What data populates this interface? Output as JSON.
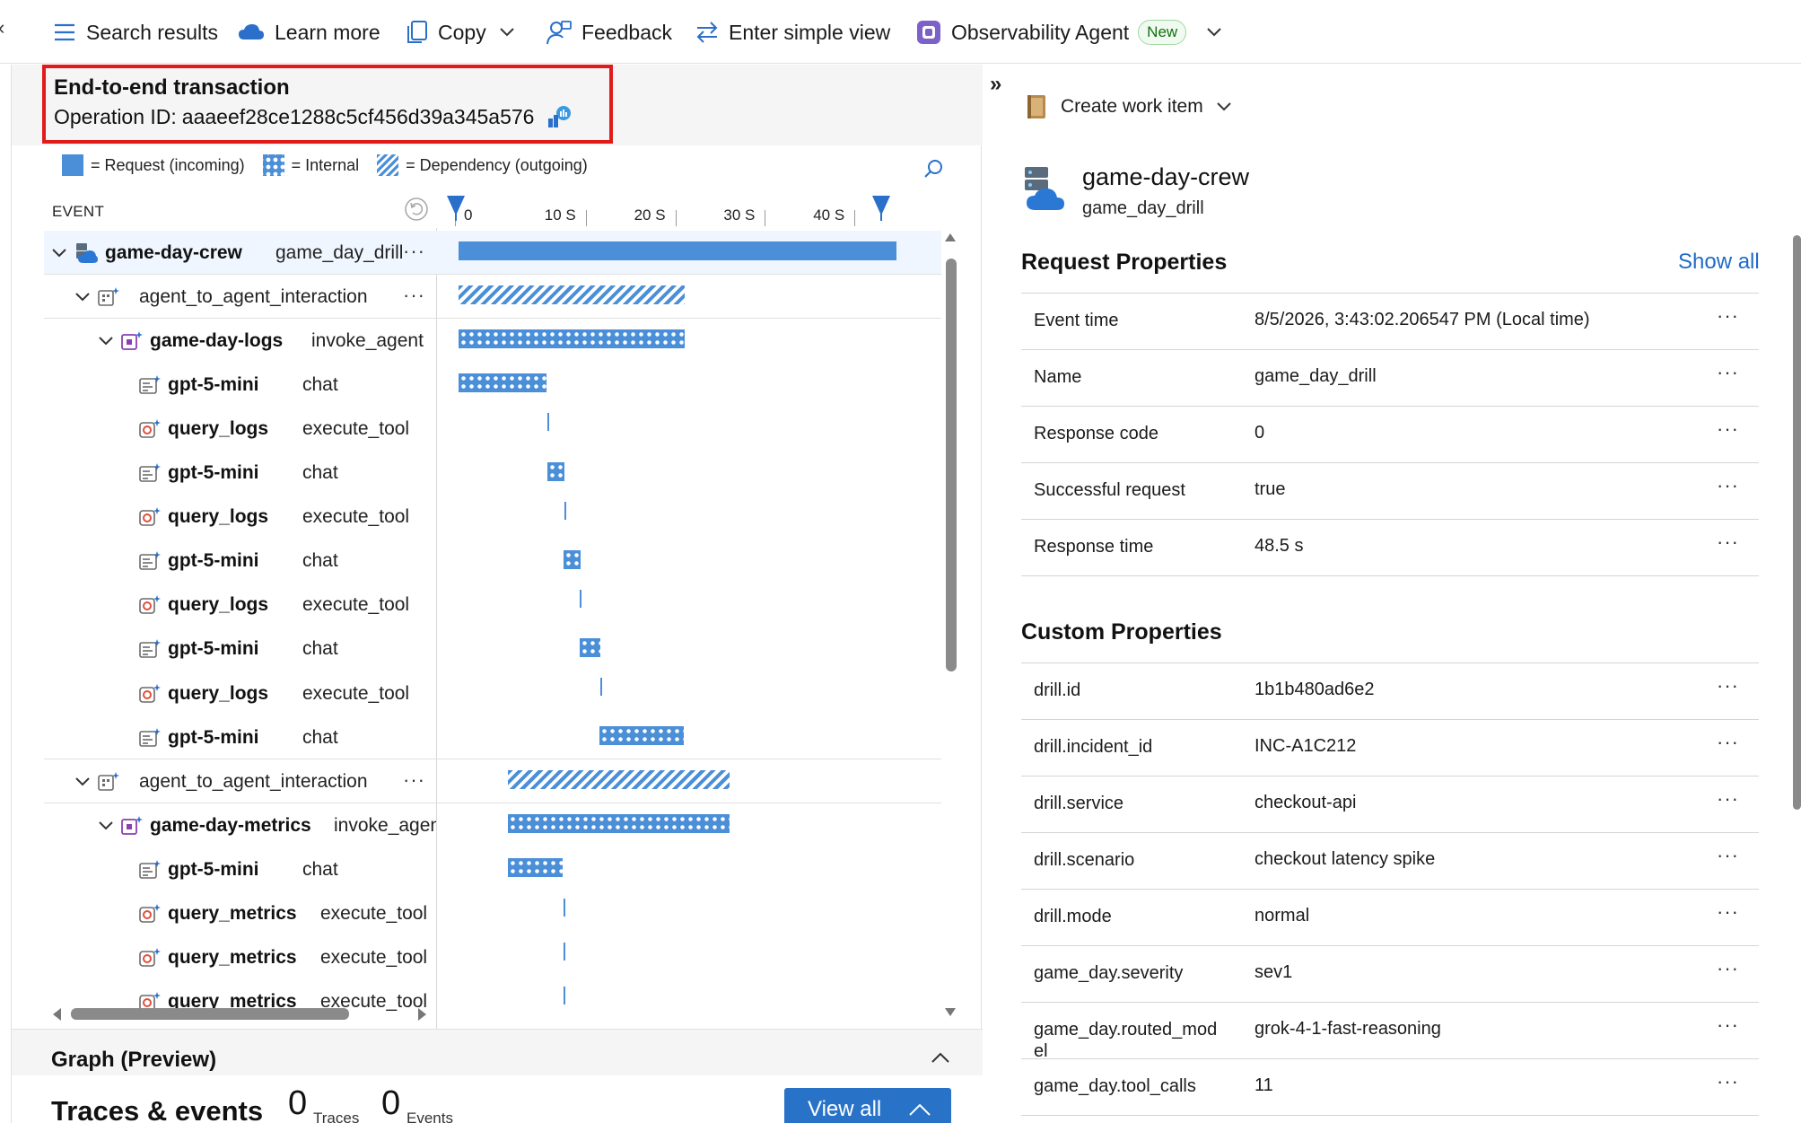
{
  "toolbar": {
    "search_results": "Search results",
    "learn_more": "Learn more",
    "copy": "Copy",
    "feedback": "Feedback",
    "simple_view": "Enter simple view",
    "agent": "Observability Agent",
    "agent_badge": "New"
  },
  "transaction": {
    "title": "End-to-end transaction",
    "operation_label": "Operation ID:",
    "operation_id": "aaaeef28ce1288c5cf456d39a345a576"
  },
  "legend": {
    "request": "= Request (incoming)",
    "internal": "= Internal",
    "dependency": "= Dependency (outgoing)"
  },
  "tree": {
    "column_header": "EVENT",
    "ticks": [
      "0",
      "10 S",
      "20 S",
      "30 S",
      "40 S"
    ],
    "duration_total_s": 48.5,
    "rows": [
      {
        "name": "game-day-crew",
        "type": "game_day_drill",
        "kind": "request",
        "start_s": 0,
        "dur_s": 48.5
      },
      {
        "name": "agent_to_agent_interaction",
        "type": "",
        "kind": "dependency",
        "start_s": 0,
        "dur_s": 25
      },
      {
        "name": "game-day-logs",
        "type": "invoke_agent",
        "kind": "internal",
        "start_s": 0,
        "dur_s": 25
      },
      {
        "name": "gpt-5-mini",
        "type": "chat",
        "kind": "internal",
        "start_s": 0,
        "dur_s": 9.7
      },
      {
        "name": "query_logs",
        "type": "execute_tool",
        "kind": "tool",
        "start_s": 9.8,
        "dur_s": 0
      },
      {
        "name": "gpt-5-mini",
        "type": "chat",
        "kind": "internal",
        "start_s": 9.8,
        "dur_s": 1.9
      },
      {
        "name": "query_logs",
        "type": "execute_tool",
        "kind": "tool",
        "start_s": 11.7,
        "dur_s": 0
      },
      {
        "name": "gpt-5-mini",
        "type": "chat",
        "kind": "internal",
        "start_s": 11.6,
        "dur_s": 1.9
      },
      {
        "name": "query_logs",
        "type": "execute_tool",
        "kind": "tool",
        "start_s": 13.4,
        "dur_s": 0
      },
      {
        "name": "gpt-5-mini",
        "type": "chat",
        "kind": "internal",
        "start_s": 13.4,
        "dur_s": 2.3
      },
      {
        "name": "query_logs",
        "type": "execute_tool",
        "kind": "tool",
        "start_s": 15.7,
        "dur_s": 0
      },
      {
        "name": "gpt-5-mini",
        "type": "chat",
        "kind": "internal",
        "start_s": 15.6,
        "dur_s": 9.4
      },
      {
        "name": "agent_to_agent_interaction",
        "type": "",
        "kind": "dependency",
        "start_s": 5.5,
        "dur_s": 24.5
      },
      {
        "name": "game-day-metrics",
        "type": "invoke_agent",
        "kind": "internal",
        "start_s": 5.5,
        "dur_s": 24.5
      },
      {
        "name": "gpt-5-mini",
        "type": "chat",
        "kind": "internal",
        "start_s": 5.5,
        "dur_s": 6
      },
      {
        "name": "query_metrics",
        "type": "execute_tool",
        "kind": "tool",
        "start_s": 11.6,
        "dur_s": 0
      },
      {
        "name": "query_metrics",
        "type": "execute_tool",
        "kind": "tool",
        "start_s": 11.6,
        "dur_s": 0
      },
      {
        "name": "query_metrics",
        "type": "execute_tool",
        "kind": "tool",
        "start_s": 11.6,
        "dur_s": 0
      }
    ]
  },
  "graph": {
    "title": "Graph (Preview)"
  },
  "traces": {
    "title": "Traces & events",
    "traces_count": "0",
    "traces_label": "Traces",
    "events_count": "0",
    "events_label": "Events",
    "view_all": "View all"
  },
  "detail": {
    "create_work_item": "Create work item",
    "service_name": "game-day-crew",
    "service_sub": "game_day_drill",
    "request_title": "Request Properties",
    "show_all": "Show all",
    "request_props": [
      {
        "key": "Event time",
        "value": "8/5/2026, 3:43:02.206547 PM (Local time)"
      },
      {
        "key": "Name",
        "value": "game_day_drill"
      },
      {
        "key": "Response code",
        "value": "0"
      },
      {
        "key": "Successful request",
        "value": "true"
      },
      {
        "key": "Response time",
        "value": "48.5 s"
      }
    ],
    "custom_title": "Custom Properties",
    "custom_props": [
      {
        "key": "drill.id",
        "value": "1b1b480ad6e2"
      },
      {
        "key": "drill.incident_id",
        "value": "INC-A1C212"
      },
      {
        "key": "drill.service",
        "value": "checkout-api"
      },
      {
        "key": "drill.scenario",
        "value": "checkout latency spike"
      },
      {
        "key": "drill.mode",
        "value": "normal"
      },
      {
        "key": "game_day.severity",
        "value": "sev1"
      },
      {
        "key": "game_day.routed_mod\nel",
        "value": "grok-4-1-fast-reasoning"
      },
      {
        "key": "game_day.tool_calls",
        "value": "11"
      }
    ]
  },
  "colors": {
    "accent": "#2872c8",
    "bar": "#4a8fd8",
    "highlight": "#e11a1a",
    "badge_green": "#0e700e"
  }
}
